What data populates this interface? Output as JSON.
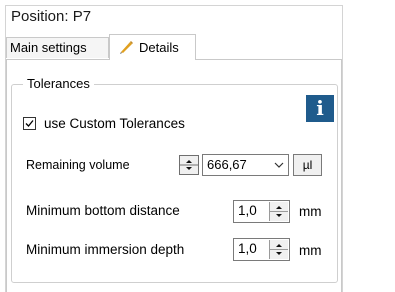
{
  "window": {
    "title": "Position: P7"
  },
  "tabs": [
    {
      "label": "Main settings",
      "active": false
    },
    {
      "label": "Details",
      "active": true,
      "icon": "pencil-icon"
    }
  ],
  "tolerances": {
    "group_label": "Tolerances",
    "info_button_label": "i",
    "use_custom": {
      "label": "use Custom Tolerances",
      "checked": true
    },
    "remaining_volume": {
      "label": "Remaining volume",
      "value": "666,67",
      "unit_button": "µl"
    },
    "min_bottom_distance": {
      "label": "Minimum bottom distance",
      "value": "1,0",
      "unit": "mm"
    },
    "min_immersion_depth": {
      "label": "Minimum immersion depth",
      "value": "1,0",
      "unit": "mm"
    }
  },
  "colors": {
    "info_button": "#1f5b8c",
    "pencil_icon": "#e0a020"
  }
}
